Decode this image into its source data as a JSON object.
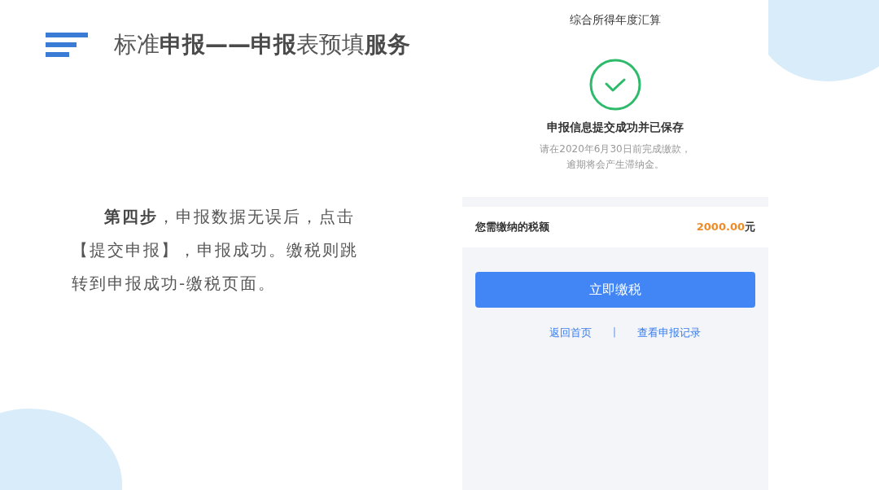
{
  "slide": {
    "title": "标准**申报——申报**表预填**服务**",
    "description": "**第四步**，申报数据无误后，点击【提交申报】，申报成功。缴税则跳转到申报成功-缴税页面。"
  },
  "phone": {
    "title": "综合所得年度汇算",
    "status": "申报信息提交成功并已保存",
    "notice": [
      "请在2020年6月30日前完成缴款，",
      "逾期将会产生滞纳金。"
    ],
    "tax_label": "您需缴纳的税额",
    "tax_amount": "2000.00",
    "tax_unit": "元",
    "pay_button": "立即缴税",
    "links": [
      "返回首页",
      "查看申报记录"
    ],
    "link_separator": "|"
  }
}
